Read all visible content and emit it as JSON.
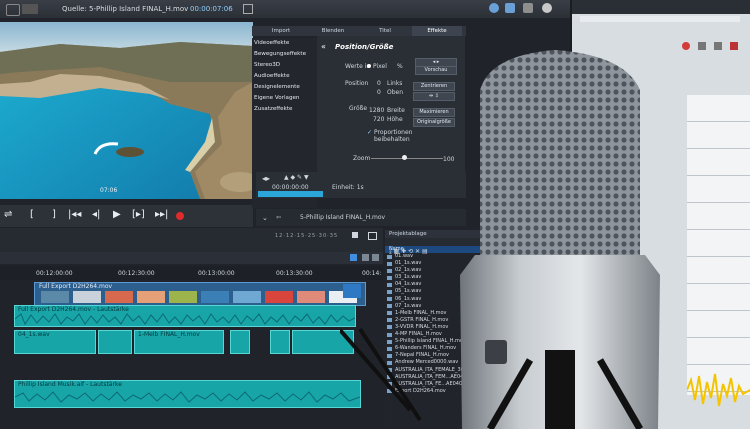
{
  "topbar": {
    "source_label": "Quelle: 5-Phillip Island FINAL_H.mov",
    "timecode": "00:00:07:06"
  },
  "preview": {
    "frame_time": "07:06"
  },
  "tabs": [
    "Import",
    "Blenden",
    "Titel",
    "Effekte"
  ],
  "sidebar": [
    "Videoeffekte",
    "Bewegungseffekte",
    "Stereo3D",
    "Audioeffekte",
    "Designelemente",
    "Eigene Vorlagen",
    "Zusatzeffekte"
  ],
  "panel": {
    "title": "Position/Größe",
    "werte_in": "Werte in",
    "pixel": "Pixel",
    "percent": "%",
    "vorschau": "Vorschau",
    "position_label": "Position",
    "pos_x": "0",
    "links": "Links",
    "pos_y": "0",
    "oben": "Oben",
    "zentrieren": "Zentrieren",
    "groesse_label": "Größe",
    "width": "1280",
    "breite": "Breite",
    "height": "720",
    "hoehe": "Höhe",
    "maximieren": "Maximieren",
    "originalgroesse": "Originalgröße",
    "proportionen": "Proportionen beibehalten",
    "zoom_label": "Zoom",
    "zoom_value": "100"
  },
  "subpanel": {
    "time": "00:00:00:00",
    "unit_label": "Einheit: 1s",
    "clip_name": "5-Phillip Island FINAL_H.mov"
  },
  "ruler": {
    "marks": [
      "00:12:00:00",
      "00:12:30:00",
      "00:13:00:00",
      "00:13:30:00",
      "00:14:"
    ]
  },
  "tracks": {
    "video_clip": "Full Export D2H264.mov",
    "audio_clip1": "Full Export D2H264.mov - Lautstärke",
    "audio_clip2": "04_1s.wav",
    "audio_clip3": "1-Melb FINAL_H.mov",
    "audio_clip4": "Phillip Island Musik.aif - Lautstärke"
  },
  "project": {
    "title": "Projektablage",
    "column": "Name",
    "items": [
      "01.wav",
      "01_1s.wav",
      "02_1s.wav",
      "03_1s.wav",
      "04_1s.wav",
      "05_1s.wav",
      "06_1s.wav",
      "07_1s.wav",
      "1-Melb FINAL_H.mov",
      "2-GSTR FINAL_H.mov",
      "3-VVDR FINAL_H.mov",
      "4-MP FINAL_H.mov",
      "5-Phillip Island FINAL_H.mov",
      "6-Wanders FINAL_H.mov",
      "7-Nepal FINAL_H.mov",
      "Andrew Merced0000.wav",
      "AUSTRALIA_ITA_FEMALE_36950000.wav",
      "AUSTRALIA_ITA_FEM...AE0400000.wav",
      "AUSTRALIA_ITA_FE...AE0400000.wav",
      "Export D2H264.mov"
    ]
  }
}
